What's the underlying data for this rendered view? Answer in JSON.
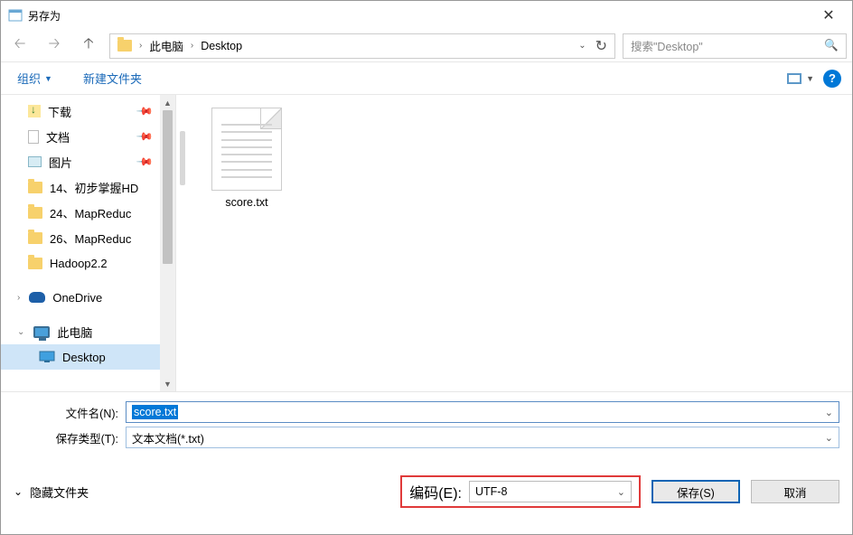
{
  "window": {
    "title": "另存为"
  },
  "breadcrumb": {
    "root": "此电脑",
    "current": "Desktop"
  },
  "search": {
    "placeholder": "搜索\"Desktop\""
  },
  "toolbar": {
    "organize": "组织",
    "new_folder": "新建文件夹"
  },
  "sidebar": {
    "items": [
      {
        "label": "下载",
        "pinned": true,
        "icon": "dl"
      },
      {
        "label": "文档",
        "pinned": true,
        "icon": "doc"
      },
      {
        "label": "图片",
        "pinned": true,
        "icon": "img"
      },
      {
        "label": "14、初步掌握HD",
        "icon": "folder"
      },
      {
        "label": "24、MapReduc",
        "icon": "folder"
      },
      {
        "label": "26、MapReduc",
        "icon": "folder"
      },
      {
        "label": "Hadoop2.2",
        "icon": "folder"
      }
    ],
    "onedrive": "OneDrive",
    "thispc": "此电脑",
    "desktop": "Desktop"
  },
  "files": [
    {
      "name": "score.txt"
    }
  ],
  "filename": {
    "label": "文件名(N):",
    "value": "score.txt"
  },
  "filetype": {
    "label": "保存类型(T):",
    "value": "文本文档(*.txt)"
  },
  "hide_folders": "隐藏文件夹",
  "encoding": {
    "label": "编码(E):",
    "value": "UTF-8"
  },
  "buttons": {
    "save": "保存(S)",
    "cancel": "取消"
  }
}
